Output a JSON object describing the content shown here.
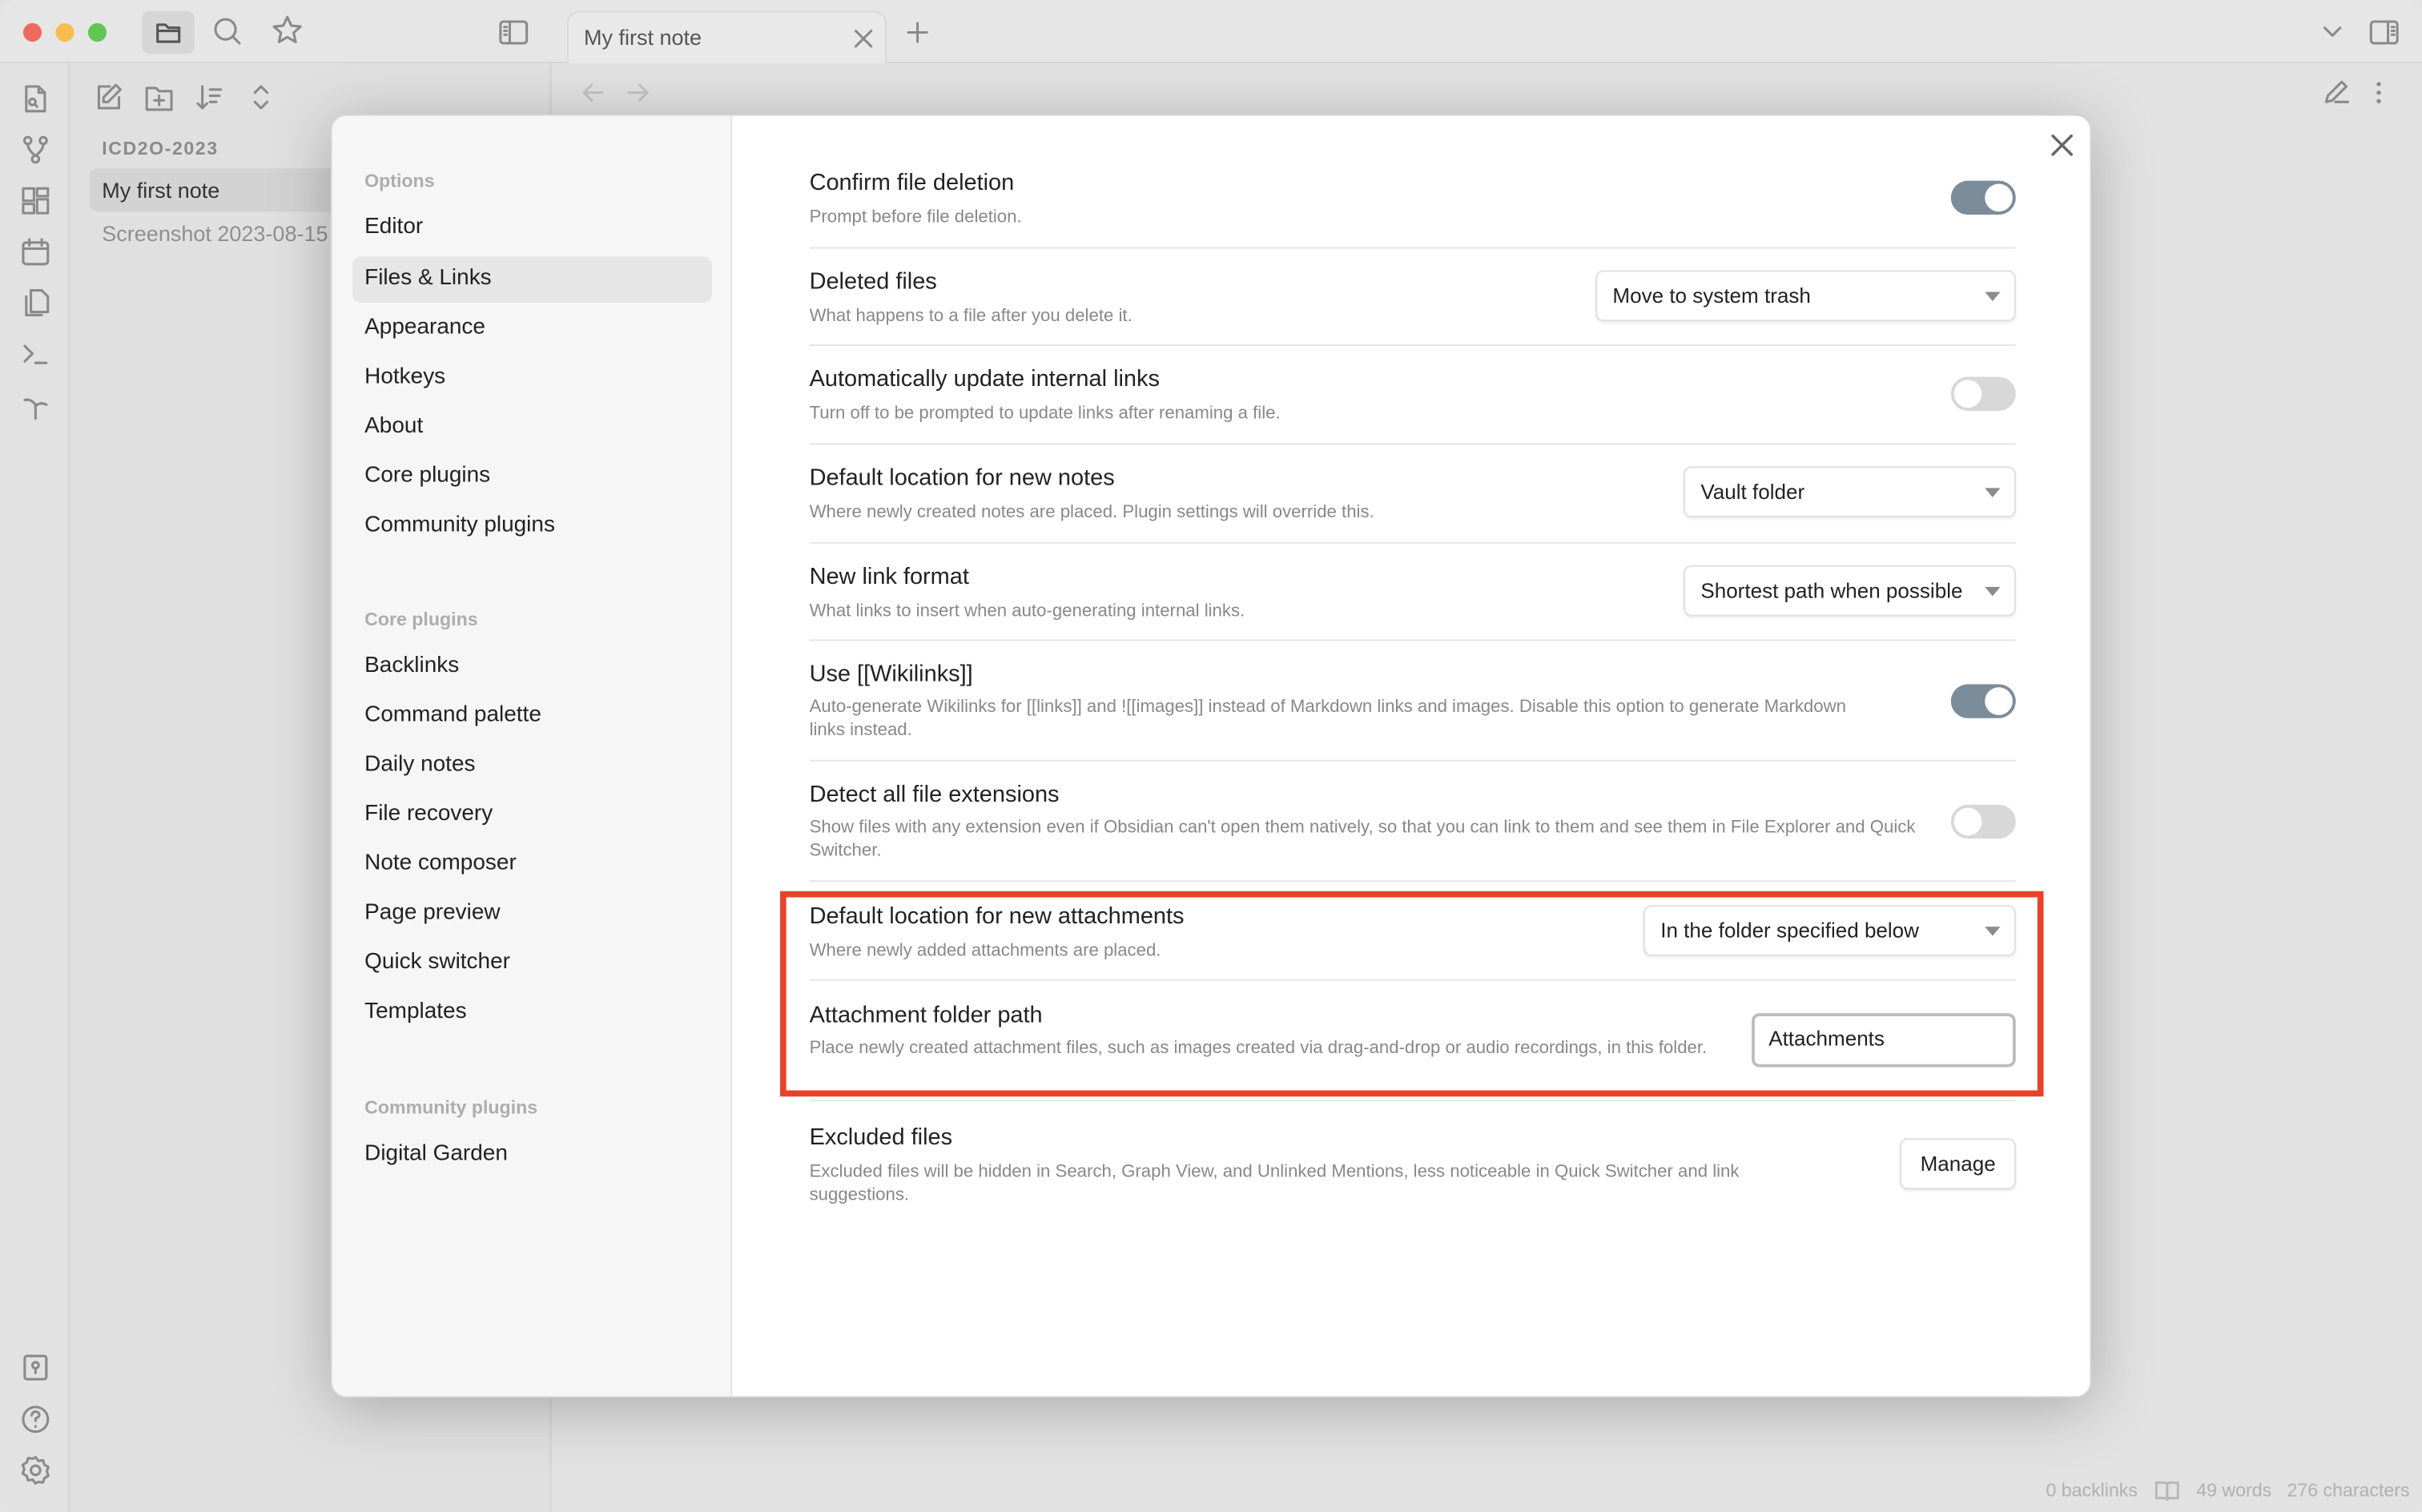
{
  "window": {
    "tabs": [
      {
        "title": "My first note"
      }
    ],
    "new_tab_icon": "plus-icon",
    "titlebar_icons": [
      "folder-icon",
      "search-icon",
      "star-icon",
      "sidebar-toggle-icon"
    ],
    "right_icons": [
      "chevron-down-icon",
      "right-sidebar-toggle-icon"
    ]
  },
  "ribbon": {
    "icons": [
      "file-search-icon",
      "graph-icon",
      "canvas-icon",
      "calendar-icon",
      "copy-icon",
      "terminal-icon",
      "sprout-icon"
    ],
    "bottom_icons": [
      "vault-icon",
      "help-icon",
      "settings-icon"
    ]
  },
  "file_explorer": {
    "toolbar_icons": [
      "new-note-icon",
      "new-folder-icon",
      "sort-icon",
      "collapse-icon"
    ],
    "vault_name": "ICD2O-2023",
    "files": [
      {
        "name": "My first note",
        "active": true
      },
      {
        "name": "Screenshot 2023-08-15",
        "active": false
      }
    ]
  },
  "status_bar": {
    "backlinks": "0 backlinks",
    "words": "49 words",
    "characters": "276 characters"
  },
  "settings": {
    "nav": {
      "options_heading": "Options",
      "options": [
        "Editor",
        "Files & Links",
        "Appearance",
        "Hotkeys",
        "About",
        "Core plugins",
        "Community plugins"
      ],
      "active": "Files & Links",
      "core_heading": "Core plugins",
      "core": [
        "Backlinks",
        "Command palette",
        "Daily notes",
        "File recovery",
        "Note composer",
        "Page preview",
        "Quick switcher",
        "Templates"
      ],
      "community_heading": "Community plugins",
      "community": [
        "Digital Garden"
      ]
    },
    "items": [
      {
        "name": "Confirm file deletion",
        "desc": "Prompt before file deletion.",
        "control": "toggle",
        "value": true
      },
      {
        "name": "Deleted files",
        "desc": "What happens to a file after you delete it.",
        "control": "dropdown",
        "value": "Move to system trash"
      },
      {
        "name": "Automatically update internal links",
        "desc": "Turn off to be prompted to update links after renaming a file.",
        "control": "toggle",
        "value": false
      },
      {
        "name": "Default location for new notes",
        "desc": "Where newly created notes are placed. Plugin settings will override this.",
        "control": "dropdown",
        "value": "Vault folder"
      },
      {
        "name": "New link format",
        "desc": "What links to insert when auto-generating internal links.",
        "control": "dropdown",
        "value": "Shortest path when possible"
      },
      {
        "name": "Use [[Wikilinks]]",
        "desc": "Auto-generate Wikilinks for [[links]] and ![[images]] instead of Markdown links and images. Disable this option to generate Markdown links instead.",
        "control": "toggle",
        "value": true
      },
      {
        "name": "Detect all file extensions",
        "desc": "Show files with any extension even if Obsidian can't open them natively, so that you can link to them and see them in File Explorer and Quick Switcher.",
        "control": "toggle",
        "value": false
      },
      {
        "name": "Default location for new attachments",
        "desc": "Where newly added attachments are placed.",
        "control": "dropdown",
        "value": "In the folder specified below"
      },
      {
        "name": "Attachment folder path",
        "desc": "Place newly created attachment files, such as images created via drag-and-drop or audio recordings, in this folder.",
        "control": "text",
        "value": "Attachments"
      },
      {
        "name": "Excluded files",
        "desc": "Excluded files will be hidden in Search, Graph View, and Unlinked Mentions, less noticeable in Quick Switcher and link suggestions.",
        "control": "button",
        "value": "Manage"
      }
    ]
  },
  "colors": {
    "toggle_on": "#7b8c9a",
    "toggle_off": "#d8d8d8",
    "highlight_box": "#e8432a",
    "traffic_red": "#ee6a5f",
    "traffic_yellow": "#f5be4f",
    "traffic_green": "#61c554"
  }
}
